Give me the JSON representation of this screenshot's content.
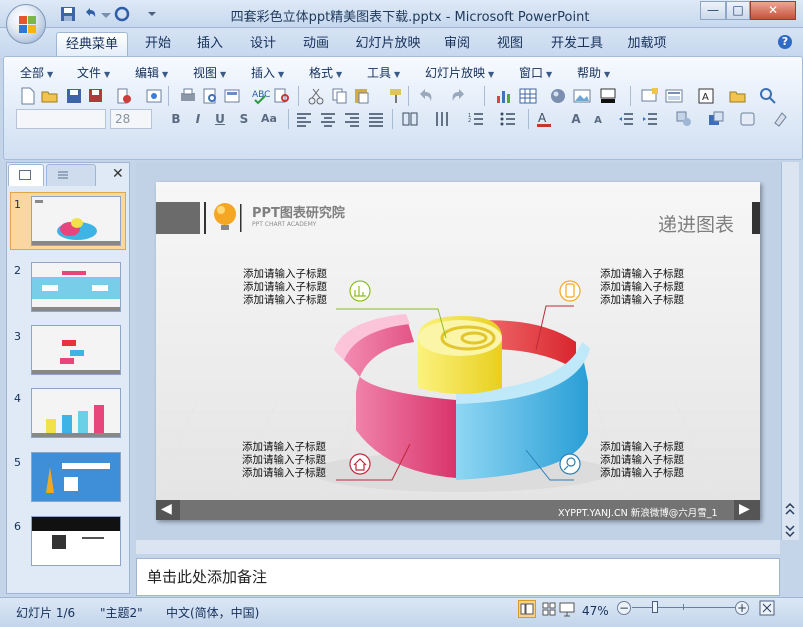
{
  "window": {
    "title": "四套彩色立体ppt精美图表下载.pptx - Microsoft PowerPoint",
    "min": "—",
    "max": "□",
    "close": "✕"
  },
  "tabs": [
    "经典菜单",
    "开始",
    "插入",
    "设计",
    "动画",
    "幻灯片放映",
    "审阅",
    "视图",
    "开发工具",
    "加载项"
  ],
  "menus": [
    "全部",
    "文件",
    "编辑",
    "视图",
    "插入",
    "格式",
    "工具",
    "幻灯片放映",
    "窗口",
    "帮助"
  ],
  "font_size_value": "28",
  "slide_panel": {
    "numbers": [
      "1",
      "2",
      "3",
      "4",
      "5",
      "6"
    ],
    "close": "✕"
  },
  "slide": {
    "brand": "PPT图表研究院",
    "brand_sub": "PPT CHART ACADEMY",
    "title": "递进图表",
    "label_line": "添加请输入子标题",
    "footer": "XYPPT.YANJ.CN  新浪微博@六月雪_1",
    "prev": "◀",
    "next": "▶"
  },
  "notes_placeholder": "单击此处添加备注",
  "status": {
    "slide": "幻灯片 1/6",
    "theme": "\"主题2\"",
    "lang": "中文(简体，中国)",
    "zoom": "47%",
    "minus": "−",
    "plus": "+"
  },
  "colors": {
    "pink": "#e8457c",
    "cyan": "#3db4e5",
    "yellow": "#f3e14a",
    "red": "#e8333a",
    "accent_orange": "#f5a623"
  }
}
